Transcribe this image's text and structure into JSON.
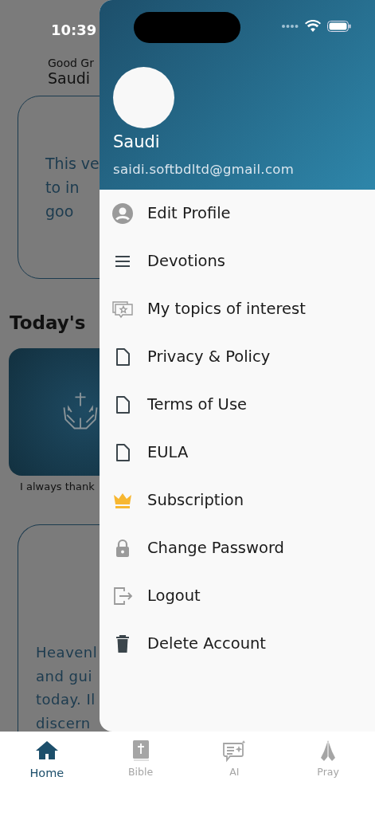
{
  "status_bar": {
    "time": "10:39"
  },
  "home": {
    "greeting": "Good Gr",
    "user_name": "Saudi",
    "verse_card": {
      "lines": [
        "This ve",
        "to in",
        "goo"
      ]
    },
    "section_title": "Today's",
    "devotion": {
      "caption": "I always thank"
    },
    "prayer_card": {
      "lines": [
        "Heavenl",
        "and gui",
        "today. Il",
        "discern"
      ]
    }
  },
  "drawer": {
    "profile": {
      "name": "Saudi",
      "email": "saidi.softbdltd@gmail.com"
    },
    "items": [
      {
        "label": "Edit Profile"
      },
      {
        "label": "Devotions"
      },
      {
        "label": "My topics of interest"
      },
      {
        "label": "Privacy & Policy"
      },
      {
        "label": "Terms of Use"
      },
      {
        "label": "EULA"
      },
      {
        "label": "Subscription"
      },
      {
        "label": "Change Password"
      },
      {
        "label": "Logout"
      },
      {
        "label": "Delete Account"
      }
    ]
  },
  "tabs": [
    {
      "label": "Home",
      "selected": true
    },
    {
      "label": "Bible",
      "selected": false
    },
    {
      "label": "AI",
      "selected": false
    },
    {
      "label": "Pray",
      "selected": false
    }
  ]
}
